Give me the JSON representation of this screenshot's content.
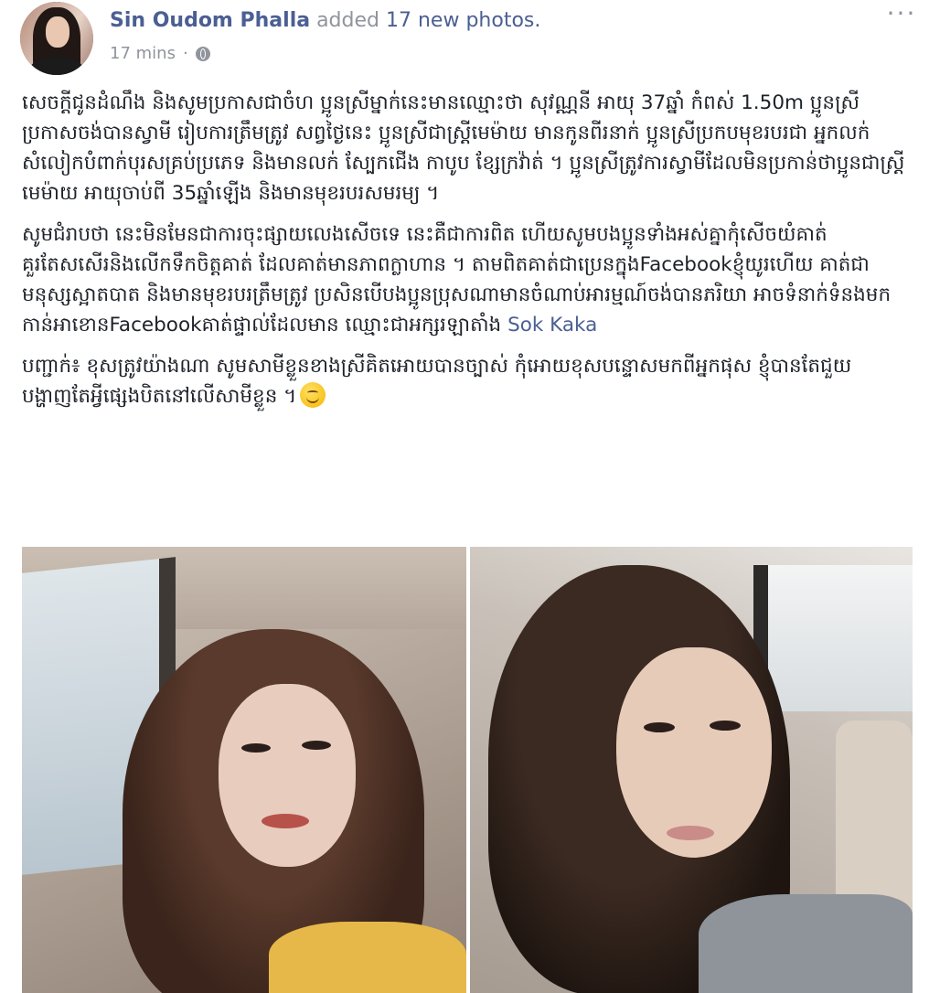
{
  "post": {
    "author_name": "Sin Oudom Phalla",
    "action_text": "added",
    "photo_count_text": "17 new photos.",
    "timestamp": "17 mins",
    "separator": "·",
    "privacy_icon": "globe-icon",
    "menu_icon": "more-options-icon",
    "menu_glyph": "···",
    "paragraphs": [
      "សេចក្តីជូនដំណឹង និងសូមប្រកាសជាចំហ ប្អូនស្រីម្នាក់នេះមានឈ្មោះថា សុវណ្ណនី អាយុ 37ឆ្នាំ កំពស់ 1.50m ប្អូនស្រីប្រកាសចង់បានស្វាមី រៀបការត្រឹមត្រូវ សព្វថ្ងៃនេះ ប្អូនស្រីជាស្ត្រីមេម៉ាយ មានកូនពីរនាក់ ប្អូនស្រីប្រកបមុខរបរជា អ្នកលក់សំលៀកបំពាក់បុរសគ្រប់ប្រភេទ និងមានលក់ ស្បែកជើង កាបូប ខ្សែក្រវ៉ាត់ ។ ប្អូនស្រីត្រូវការស្វាមីដែលមិនប្រកាន់ថាប្អូនជាស្ត្រីមេម៉ាយ អាយុចាប់ពី 35ឆ្នាំឡើង និងមានមុខរបរសមរម្យ ។",
      "សូមជំរាបថា នេះមិនមែនជាការចុះផ្សាយលេងសើចទេ នេះគឺជាការពិត ហើយសូមបងប្អូនទាំងអស់គ្នាកុំសើចយំគាត់ គួរតែសសើរនិងលើកទឹកចិត្តគាត់ ដែលគាត់មានភាពក្លាហាន ។ តាមពិតគាត់ជាប្រេនក្នុងFacebookខ្ញុំយូរហើយ គាត់ជាមនុស្សស្អាតបាត និងមានមុខរបរត្រឹមត្រូវ ប្រសិនបើបងប្អូនប្រុសណាមានចំណាប់អារម្មណ៍ចង់បានភរិយា អាចទំនាក់ទំនងមកកាន់អាខោនFacebookគាត់ផ្ទាល់ដែលមាន ឈ្មោះជាអក្សរឡាតាំង"
    ],
    "mention": "Sok Kaka",
    "paragraph3": "បញ្ជាក់៖ ខុសត្រូវយ៉ាងណា សូមសាមីខ្លួនខាងស្រីគិតអោយបានច្បាស់ កុំអោយខុសបន្ទោសមកពីអ្នកផុស ខ្ញុំបានតែជួយបង្ហាញតែអ្វីផ្សេងបិតនៅលើសាមីខ្លួន ។",
    "emoji": "smiling-face-emoji",
    "photos": [
      {
        "name": "photo-1",
        "subject": "selfie-in-car"
      },
      {
        "name": "photo-2",
        "subject": "selfie-in-car"
      }
    ]
  },
  "colors": {
    "link": "#4b5f93",
    "meta": "#90949c",
    "text": "#1d2129"
  }
}
